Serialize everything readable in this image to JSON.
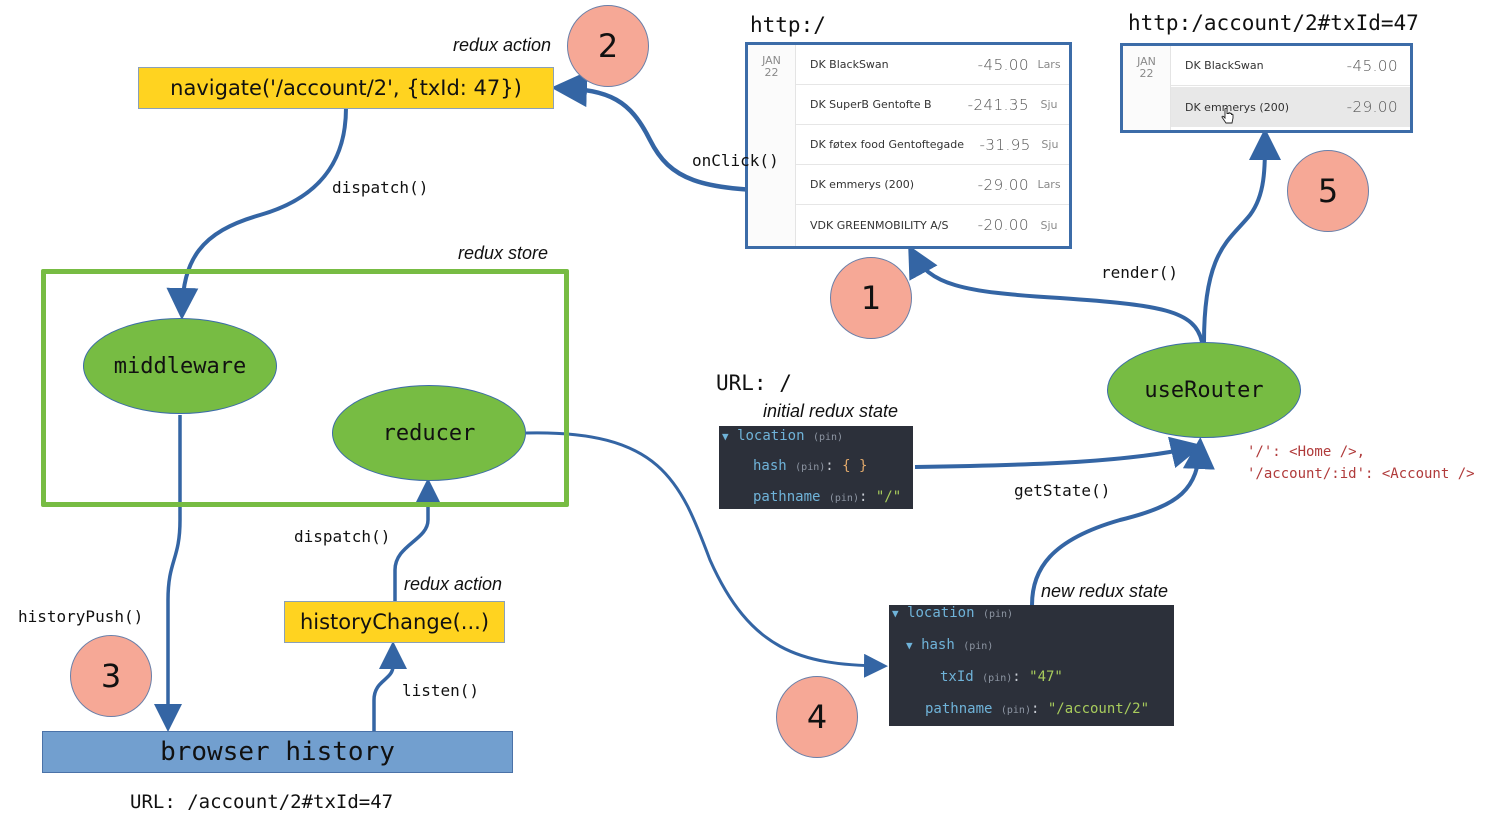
{
  "colors": {
    "arrow": "#3465a4",
    "node_fill": "#77bc43",
    "action_fill": "#ffd320",
    "badge_fill": "#f6a896",
    "history_fill": "#729fcf",
    "state_bg": "#2c303a"
  },
  "steps": [
    "1",
    "2",
    "3",
    "4",
    "5"
  ],
  "actions": {
    "navigate": {
      "caption": "redux action",
      "label": "navigate('/account/2', {txId: 47})"
    },
    "history_change": {
      "caption": "redux action",
      "label": "historyChange(...)"
    }
  },
  "store": {
    "caption": "redux store",
    "middleware": "middleware",
    "reducer": "reducer"
  },
  "router": {
    "label": "useRouter",
    "routes": [
      "'/': <Home />,",
      "'/account/:id': <Account />"
    ]
  },
  "history": {
    "label": "browser history",
    "url": "URL: /account/2#txId=47"
  },
  "edges": {
    "on_click": "onClick()",
    "dispatch_top": "dispatch()",
    "dispatch_bottom": "dispatch()",
    "history_push": "historyPush()",
    "listen": "listen()",
    "get_state": "getState()",
    "render": "render()"
  },
  "initial_state": {
    "url": "URL: /",
    "caption": "initial redux state",
    "rows": {
      "location": "location",
      "hash": "hash",
      "hash_value": "{ }",
      "pathname": "pathname",
      "pathname_value": "\"/\""
    },
    "pin": "(pin)"
  },
  "new_state": {
    "caption": "new redux state",
    "rows": {
      "location": "location",
      "hash": "hash",
      "txid": "txId",
      "txid_value": "\"47\"",
      "pathname": "pathname",
      "pathname_value": "\"/account/2\""
    },
    "pin": "(pin)"
  },
  "screen_before": {
    "url": "http:/",
    "date_month": "JAN",
    "date_day": "22",
    "transactions": [
      {
        "name": "DK BlackSwan",
        "amount": "-45.00",
        "who": "Lars"
      },
      {
        "name": "DK SuperB Gentofte B",
        "amount": "-241.35",
        "who": "Sju"
      },
      {
        "name": "DK føtex food Gentoftegade",
        "amount": "-31.95",
        "who": "Sju"
      },
      {
        "name": "DK emmerys (200)",
        "amount": "-29.00",
        "who": "Lars"
      },
      {
        "name": "VDK GREENMOBILITY A/S",
        "amount": "-20.00",
        "who": "Sju"
      }
    ]
  },
  "screen_after": {
    "url": "http:/account/2#txId=47",
    "date_month": "JAN",
    "date_day": "22",
    "transactions": [
      {
        "name": "DK BlackSwan",
        "amount": "-45.00"
      },
      {
        "name": "DK emmerys (200)",
        "amount": "-29.00",
        "selected": true
      }
    ]
  }
}
